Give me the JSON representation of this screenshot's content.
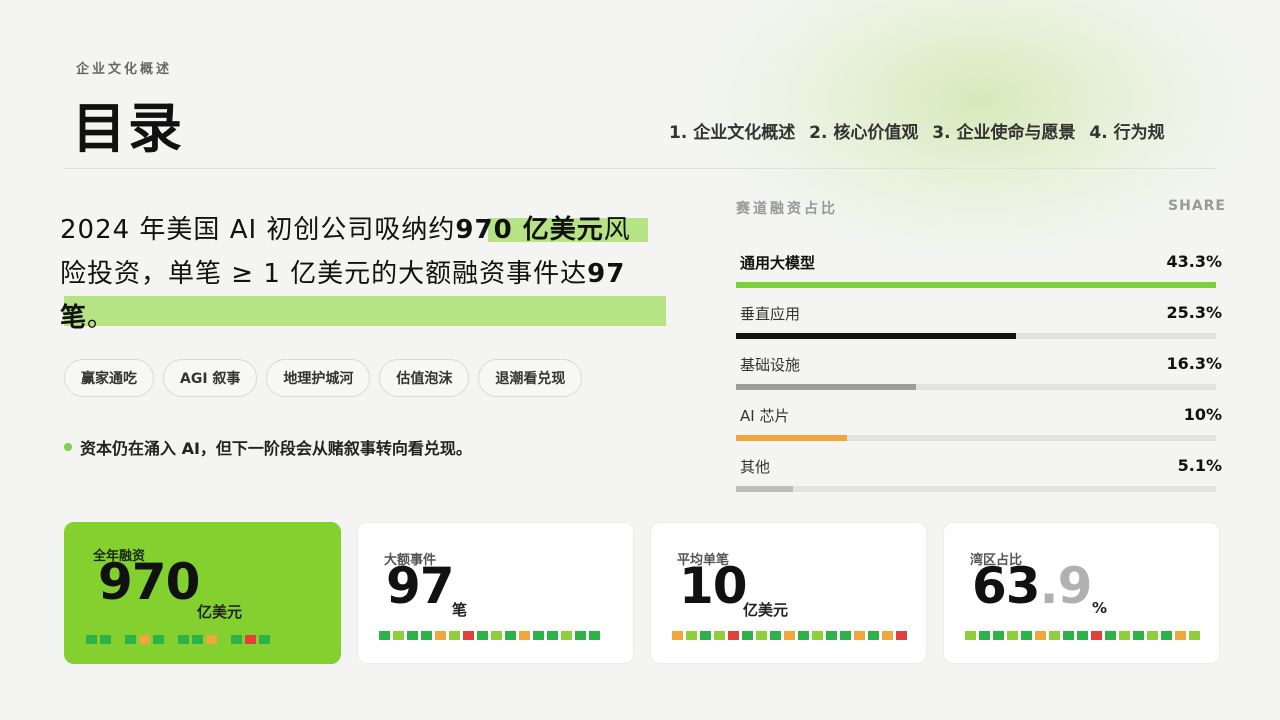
{
  "header": {
    "eyebrow": "企业文化概述",
    "title": "目录",
    "toc": [
      "1. 企业文化概述",
      "2. 核心价值观",
      "3. 企业使命与愿景",
      "4. 行为规"
    ]
  },
  "headline": {
    "line1_pre": "2024 年美国 AI 初创公司吸纳约",
    "line1_bold": "970 亿美元",
    "line1_post": "风",
    "line2_pre": "险投资，单笔 ≥ 1 亿美元的大额融资事件达",
    "line2_bold": "97",
    "line3_bold": "笔",
    "line3_post": "。"
  },
  "chips": [
    "赢家通吃",
    "AGI 叙事",
    "地理护城河",
    "估值泡沫",
    "退潮看兑现"
  ],
  "note": "资本仍在涌入 AI，但下一阶段会从赌叙事转向看兑现。",
  "share": {
    "title": "赛道融资占比",
    "tag": "SHARE",
    "items": [
      {
        "label": "通用大模型",
        "value": "43.3%",
        "pct": 100,
        "color": "#7cd03a"
      },
      {
        "label": "垂直应用",
        "value": "25.3%",
        "pct": 58.4,
        "color": "#111111"
      },
      {
        "label": "基础设施",
        "value": "16.3%",
        "pct": 37.6,
        "color": "#9b9d96"
      },
      {
        "label": "AI 芯片",
        "value": "10%",
        "pct": 23.1,
        "color": "#f0a63a"
      },
      {
        "label": "其他",
        "value": "5.1%",
        "pct": 11.8,
        "color": "#bcbcbc"
      }
    ]
  },
  "cards": [
    {
      "label": "全年融资",
      "value": "970",
      "decimal": "",
      "unit": "亿美元"
    },
    {
      "label": "大额事件",
      "value": "97",
      "decimal": "",
      "unit": "笔"
    },
    {
      "label": "平均单笔",
      "value": "10",
      "decimal": "",
      "unit": "亿美元"
    },
    {
      "label": "湾区占比",
      "value": "63",
      "decimal": ".9",
      "unit": "%"
    }
  ],
  "colors": {
    "green": "#2db24a",
    "lime": "#8fd03a",
    "orange": "#f0a63a",
    "red": "#e0413a"
  }
}
